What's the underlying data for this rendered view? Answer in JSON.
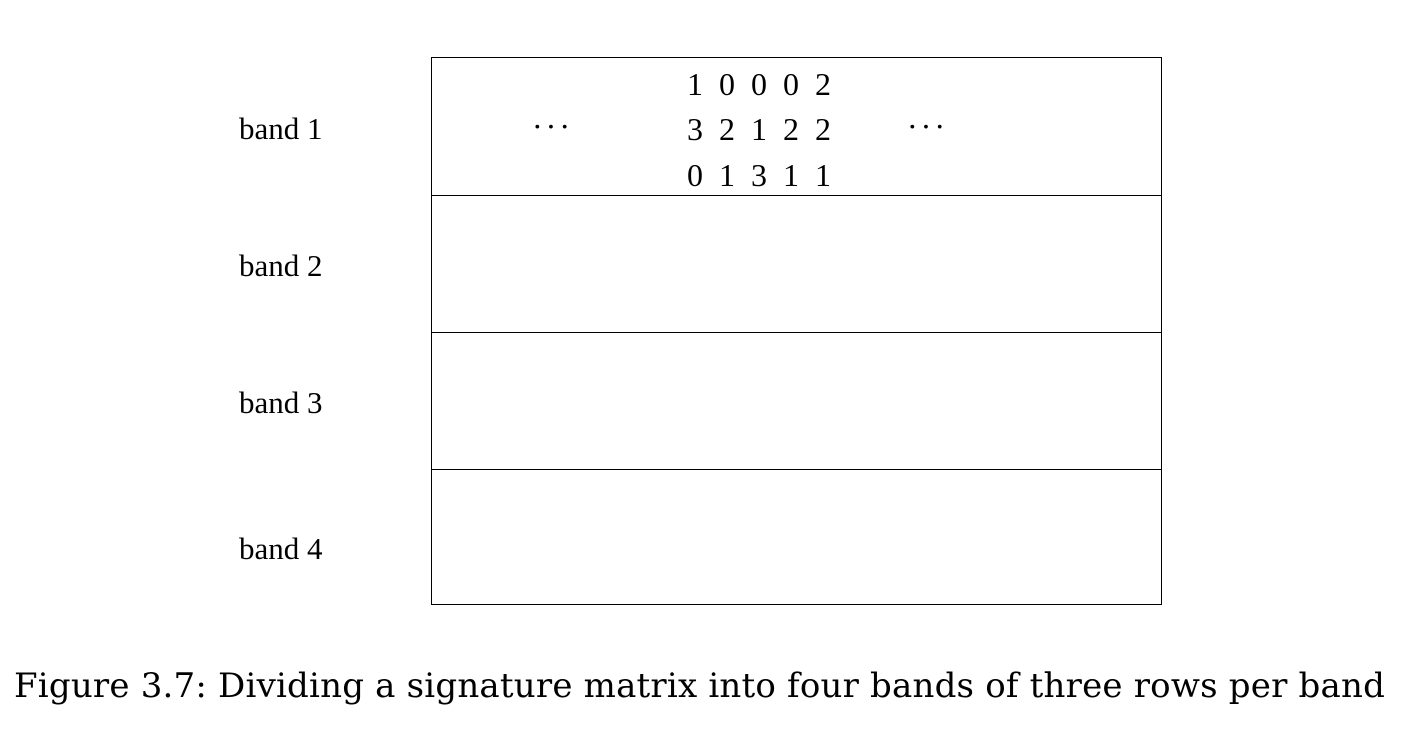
{
  "bands": [
    {
      "label": "band 1",
      "rows": [
        "1 0 0 0 2",
        "3 2 1 2 2",
        "0 1 3 1 1"
      ],
      "left_ellipsis": "···",
      "right_ellipsis": "···"
    },
    {
      "label": "band 2",
      "rows": []
    },
    {
      "label": "band 3",
      "rows": []
    },
    {
      "label": "band 4",
      "rows": []
    }
  ],
  "caption": "Figure 3.7: Dividing a signature matrix into four bands of three rows per band"
}
